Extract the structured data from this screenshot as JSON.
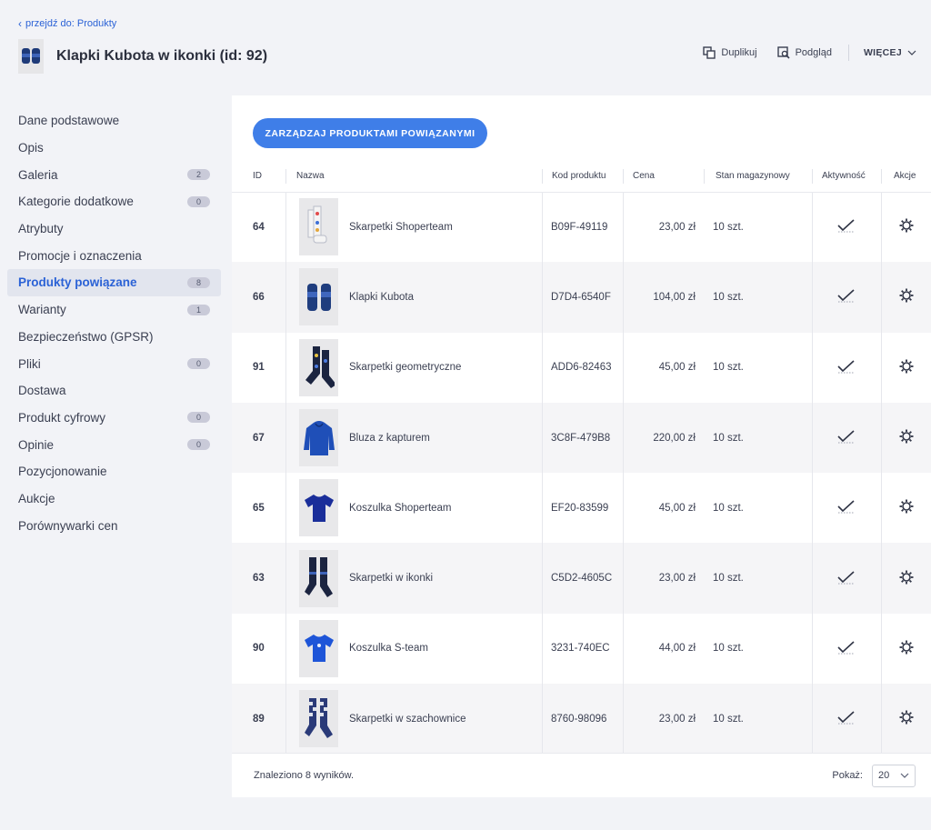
{
  "nav": {
    "back_link": "przejdź do: Produkty"
  },
  "product": {
    "title": "Klapki Kubota w ikonki (id: 92)",
    "thumb_icon": "slippers-icon"
  },
  "toolbar": {
    "duplicate": "Duplikuj",
    "preview": "Podgląd",
    "more": "WIĘCEJ"
  },
  "sidebar": {
    "items": [
      {
        "label": "Dane podstawowe",
        "badge": null
      },
      {
        "label": "Opis",
        "badge": null
      },
      {
        "label": "Galeria",
        "badge": "2"
      },
      {
        "label": "Kategorie dodatkowe",
        "badge": "0"
      },
      {
        "label": "Atrybuty",
        "badge": null
      },
      {
        "label": "Promocje i oznaczenia",
        "badge": null
      },
      {
        "label": "Produkty powiązane",
        "badge": "8",
        "active": true
      },
      {
        "label": "Warianty",
        "badge": "1"
      },
      {
        "label": "Bezpieczeństwo (GPSR)",
        "badge": null
      },
      {
        "label": "Pliki",
        "badge": "0"
      },
      {
        "label": "Dostawa",
        "badge": null
      },
      {
        "label": "Produkt cyfrowy",
        "badge": "0"
      },
      {
        "label": "Opinie",
        "badge": "0"
      },
      {
        "label": "Pozycjonowanie",
        "badge": null
      },
      {
        "label": "Aukcje",
        "badge": null
      },
      {
        "label": "Porównywarki cen",
        "badge": null
      }
    ]
  },
  "main": {
    "manage_button": "ZARZĄDZAJ PRODUKTAMI POWIĄZANYMI",
    "columns": {
      "id": "ID",
      "name": "Nazwa",
      "code": "Kod produktu",
      "price": "Cena",
      "stock": "Stan magazynowy",
      "active": "Aktywność",
      "actions": "Akcje"
    },
    "rows": [
      {
        "id": "64",
        "name": "Skarpetki Shoperteam",
        "code": "B09F-49119",
        "price": "23,00 zł",
        "stock": "10 szt.",
        "image": "socks-pattern"
      },
      {
        "id": "66",
        "name": "Klapki Kubota",
        "code": "D7D4-6540F",
        "price": "104,00 zł",
        "stock": "10 szt.",
        "image": "slippers"
      },
      {
        "id": "91",
        "name": "Skarpetki geometryczne",
        "code": "ADD6-82463",
        "price": "45,00 zł",
        "stock": "10 szt.",
        "image": "socks-dark"
      },
      {
        "id": "67",
        "name": "Bluza z kapturem",
        "code": "3C8F-479B8",
        "price": "220,00 zł",
        "stock": "10 szt.",
        "image": "hoodie"
      },
      {
        "id": "65",
        "name": "Koszulka Shoperteam",
        "code": "EF20-83599",
        "price": "45,00 zł",
        "stock": "10 szt.",
        "image": "tshirt-dark"
      },
      {
        "id": "63",
        "name": "Skarpetki w ikonki",
        "code": "C5D2-4605C",
        "price": "23,00 zł",
        "stock": "10 szt.",
        "image": "socks-navy"
      },
      {
        "id": "90",
        "name": "Koszulka S-team",
        "code": "3231-740EC",
        "price": "44,00 zł",
        "stock": "10 szt.",
        "image": "tshirt-blue"
      },
      {
        "id": "89",
        "name": "Skarpetki w szachownice",
        "code": "8760-98096",
        "price": "23,00 zł",
        "stock": "10 szt.",
        "image": "socks-check"
      }
    ],
    "found": "Znaleziono 8 wyników.",
    "show_label": "Pokaż:",
    "show_value": "20"
  }
}
